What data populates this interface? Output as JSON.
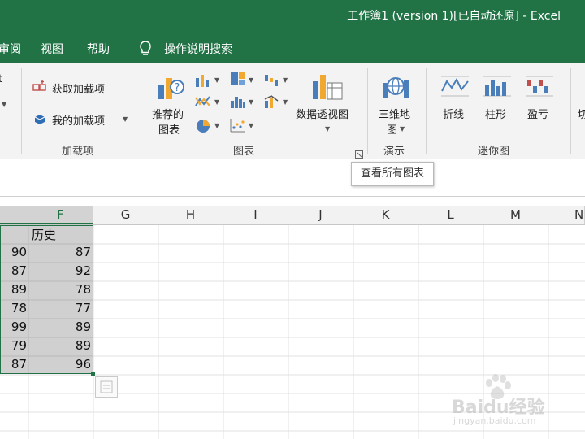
{
  "window": {
    "title": "工作簿1 (version 1)[已自动还原]  -  Excel"
  },
  "menu": {
    "items": [
      "审阅",
      "视图",
      "帮助"
    ],
    "search_label": "操作说明搜索"
  },
  "ribbon": {
    "partial_left_top": "t",
    "addins": {
      "get_addins": "获取加载项",
      "my_addins": "我的加载项",
      "group_label": "加载项"
    },
    "charts": {
      "recommended_line1": "推荐的",
      "recommended_line2": "图表",
      "pivot_chart": "数据透视图",
      "group_label": "图表"
    },
    "tours": {
      "map3d_line1": "三维地",
      "map3d_line2": "图",
      "group_label": "演示"
    },
    "sparklines": {
      "line": "折线",
      "column": "柱形",
      "win_loss": "盈亏",
      "group_label": "迷你图"
    },
    "partial_right": "切"
  },
  "tooltip": {
    "text": "查看所有图表"
  },
  "sheet": {
    "columns": [
      "F",
      "G",
      "H",
      "I",
      "J",
      "K",
      "L",
      "M",
      "N"
    ],
    "header_cell": "历史",
    "rows": [
      [
        "90",
        "87"
      ],
      [
        "87",
        "92"
      ],
      [
        "89",
        "78"
      ],
      [
        "78",
        "77"
      ],
      [
        "99",
        "89"
      ],
      [
        "79",
        "89"
      ],
      [
        "87",
        "96"
      ]
    ]
  },
  "watermark": {
    "brand": "Baidu经验",
    "url": "jingyan.baidu.com"
  },
  "colors": {
    "excel_green": "#217346",
    "selection_gray": "#d0d0d0"
  }
}
